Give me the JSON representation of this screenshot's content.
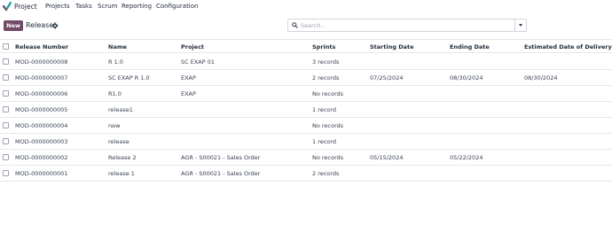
{
  "navbar": {
    "app_name": "Project",
    "menus": [
      "Projects",
      "Tasks",
      "Scrum",
      "Reporting",
      "Configuration"
    ]
  },
  "control": {
    "new_label": "New",
    "breadcrumb": "Release"
  },
  "search": {
    "placeholder": "Search...",
    "value": ""
  },
  "table": {
    "columns": [
      "Release Number",
      "Name",
      "Project",
      "Sprints",
      "Starting Date",
      "Ending Date",
      "Estimated Date of Delivery"
    ],
    "rows": [
      {
        "number": "MOD-0000000008",
        "name": "R 1.0",
        "project": "SC EXAP 01",
        "sprints": "3 records",
        "start": "",
        "end": "",
        "delivery": ""
      },
      {
        "number": "MOD-0000000007",
        "name": "SC EXAP R 1.0",
        "project": "EXAP",
        "sprints": "2 records",
        "start": "07/25/2024",
        "end": "08/30/2024",
        "delivery": "08/30/2024"
      },
      {
        "number": "MOD-0000000006",
        "name": "R1.0",
        "project": "EXAP",
        "sprints": "No records",
        "start": "",
        "end": "",
        "delivery": ""
      },
      {
        "number": "MOD-0000000005",
        "name": "release1",
        "project": "",
        "sprints": "1 record",
        "start": "",
        "end": "",
        "delivery": ""
      },
      {
        "number": "MOD-0000000004",
        "name": "new",
        "project": "",
        "sprints": "No records",
        "start": "",
        "end": "",
        "delivery": ""
      },
      {
        "number": "MOD-0000000003",
        "name": "release",
        "project": "",
        "sprints": "1 record",
        "start": "",
        "end": "",
        "delivery": ""
      },
      {
        "number": "MOD-0000000002",
        "name": "Release 2",
        "project": "AGR - S00021 - Sales Order",
        "sprints": "No records",
        "start": "05/15/2024",
        "end": "05/22/2024",
        "delivery": ""
      },
      {
        "number": "MOD-0000000001",
        "name": "release 1",
        "project": "AGR - S00021 - Sales Order",
        "sprints": "2 records",
        "start": "",
        "end": "",
        "delivery": ""
      }
    ]
  },
  "colors": {
    "brand": "#714b67",
    "logo_teal": "#1aa5a0",
    "logo_purple": "#714b67"
  }
}
